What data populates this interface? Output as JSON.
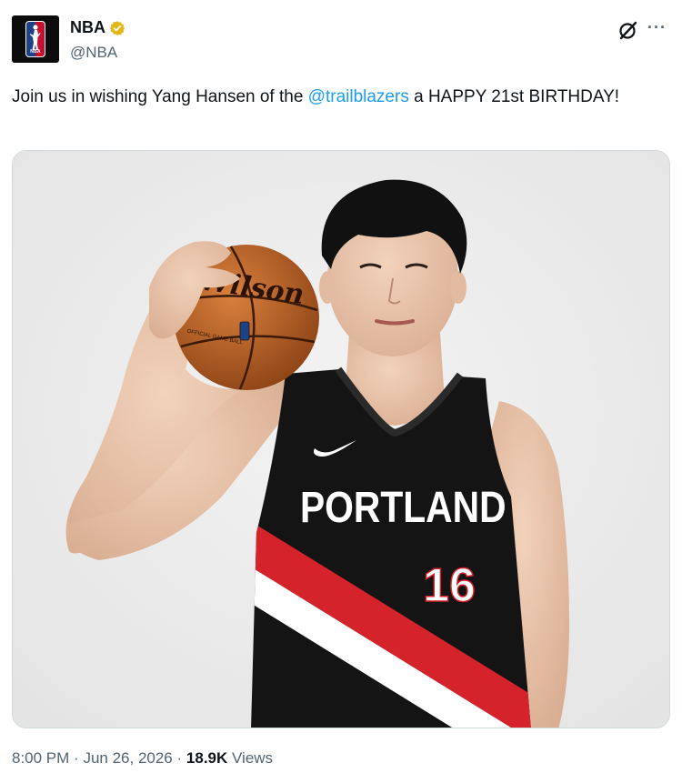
{
  "account": {
    "display_name": "NBA",
    "handle": "@NBA",
    "avatar_text": "NBA",
    "verified_icon": "verified-badge-icon"
  },
  "tweet": {
    "text_before": "Join us in wishing Yang Hansen of the ",
    "mention": "@trailblazers",
    "text_after": " a HAPPY 21st BIRTHDAY!"
  },
  "media": {
    "ball_brand": "Wilson",
    "ball_subtext": "OFFICIAL GAME BALL",
    "jersey_team": "PORTLAND",
    "jersey_number": "16"
  },
  "meta": {
    "time": "8:00 PM",
    "separator": "·",
    "date": "Jun 26, 2026",
    "views_count": "18.9K",
    "views_label": "Views"
  },
  "colors": {
    "link": "#1d9bf0",
    "secondary_text": "#536471",
    "verified_gold": "#e2b719",
    "jersey_red": "#d5232b",
    "jersey_black": "#141414"
  }
}
